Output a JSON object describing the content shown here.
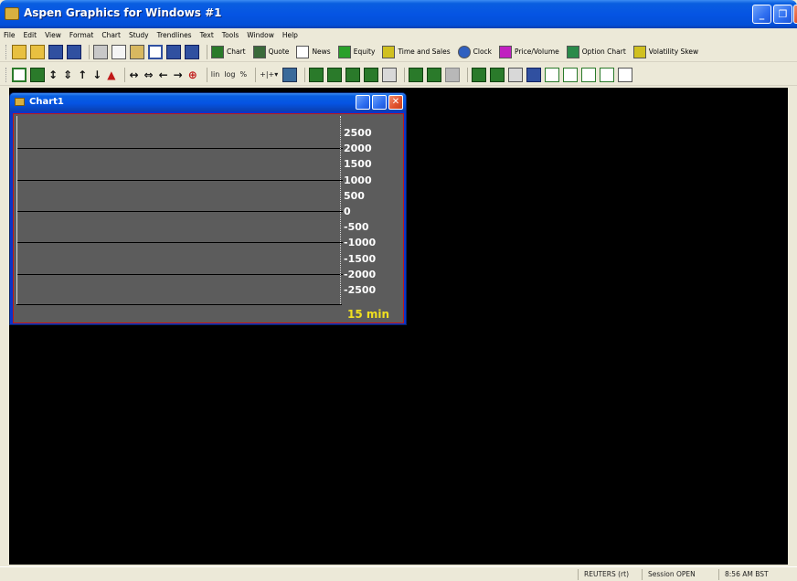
{
  "window": {
    "title": "Aspen Graphics for Windows #1"
  },
  "menu": [
    "File",
    "Edit",
    "View",
    "Format",
    "Chart",
    "Study",
    "Trendlines",
    "Text",
    "Tools",
    "Window",
    "Help"
  ],
  "toolbar1": {
    "buttons": [
      {
        "label": "Chart",
        "color": "#2a7a2a"
      },
      {
        "label": "Quote",
        "color": "#3a6a3a"
      },
      {
        "label": "News",
        "color": "#ffffff"
      },
      {
        "label": "Equity",
        "color": "#2aa02a"
      },
      {
        "label": "Time and Sales",
        "color": "#d0c020"
      },
      {
        "label": "Clock",
        "color": "#3060c0"
      },
      {
        "label": "Price/Volume",
        "color": "#c020c0"
      },
      {
        "label": "Option Chart",
        "color": "#2a8a4a"
      },
      {
        "label": "Volatility Skew",
        "color": "#d0c020"
      }
    ]
  },
  "toolbar2": {
    "scale_lin": "lin",
    "scale_log": "log",
    "scale_pct": "%"
  },
  "chart": {
    "title": "Chart1",
    "y_ticks": [
      "2500",
      "2000",
      "1500",
      "1000",
      "500",
      "0",
      "-500",
      "-1000",
      "-1500",
      "-2000",
      "-2500"
    ],
    "interval": "15 min",
    "colors": {
      "background": "#5c5c5c",
      "axis_text": "#ffffff",
      "interval_text": "#f0e020",
      "border": "#c01818"
    }
  },
  "status": {
    "source": "REUTERS (rt)",
    "session": "Session OPEN",
    "time": "8:56 AM BST"
  }
}
